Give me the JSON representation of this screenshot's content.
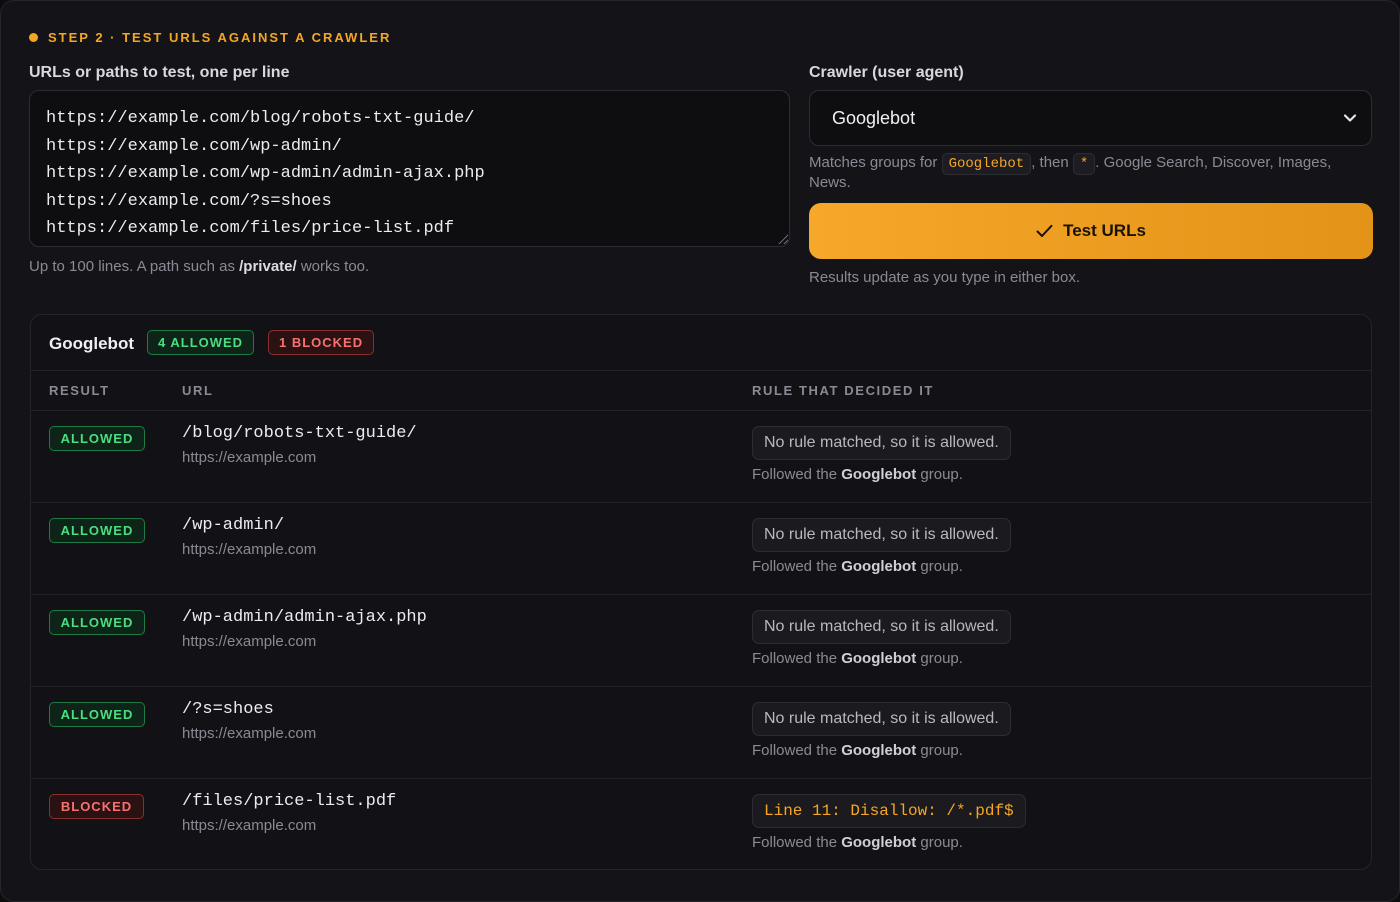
{
  "step": {
    "label": "STEP 2 · TEST URLS AGAINST A CRAWLER"
  },
  "urls": {
    "label": "URLs or paths to test, one per line",
    "value": "https://example.com/blog/robots-txt-guide/\nhttps://example.com/wp-admin/\nhttps://example.com/wp-admin/admin-ajax.php\nhttps://example.com/?s=shoes\nhttps://example.com/files/price-list.pdf",
    "hint_pre": "Up to 100 lines. A path such as ",
    "hint_bold": "/private/",
    "hint_post": " works too."
  },
  "crawler": {
    "label": "Crawler (user agent)",
    "selected": "Googlebot",
    "match_pre": "Matches groups for ",
    "match_agent": "Googlebot",
    "match_mid": ", then ",
    "match_star": "*",
    "match_post": ". Google Search, Discover, Images, News."
  },
  "test_button": {
    "label": "Test URLs"
  },
  "update_note": "Results update as you type in either box.",
  "results": {
    "title": "Googlebot",
    "allowed_count": "4 ALLOWED",
    "blocked_count": "1 BLOCKED",
    "columns": {
      "result": "RESULT",
      "url": "URL",
      "rule": "RULE THAT DECIDED IT"
    },
    "rows": [
      {
        "status": "ALLOWED",
        "path": "/blog/robots-txt-guide/",
        "host": "https://example.com",
        "rule": "No rule matched, so it is allowed.",
        "followed_pre": "Followed the ",
        "followed_group": "Googlebot",
        "followed_post": " group."
      },
      {
        "status": "ALLOWED",
        "path": "/wp-admin/",
        "host": "https://example.com",
        "rule": "No rule matched, so it is allowed.",
        "followed_pre": "Followed the ",
        "followed_group": "Googlebot",
        "followed_post": " group."
      },
      {
        "status": "ALLOWED",
        "path": "/wp-admin/admin-ajax.php",
        "host": "https://example.com",
        "rule": "No rule matched, so it is allowed.",
        "followed_pre": "Followed the ",
        "followed_group": "Googlebot",
        "followed_post": " group."
      },
      {
        "status": "ALLOWED",
        "path": "/?s=shoes",
        "host": "https://example.com",
        "rule": "No rule matched, so it is allowed.",
        "followed_pre": "Followed the ",
        "followed_group": "Googlebot",
        "followed_post": " group."
      },
      {
        "status": "BLOCKED",
        "path": "/files/price-list.pdf",
        "host": "https://example.com",
        "rule": "Line 11: Disallow: /*.pdf$",
        "followed_pre": "Followed the ",
        "followed_group": "Googlebot",
        "followed_post": " group."
      }
    ]
  },
  "icons": {
    "step": "dot-icon",
    "select": "chevron-down-icon",
    "button": "check-icon"
  },
  "colors": {
    "accent": "#f5a623",
    "allowed": "#4ade80",
    "blocked": "#f87171"
  }
}
